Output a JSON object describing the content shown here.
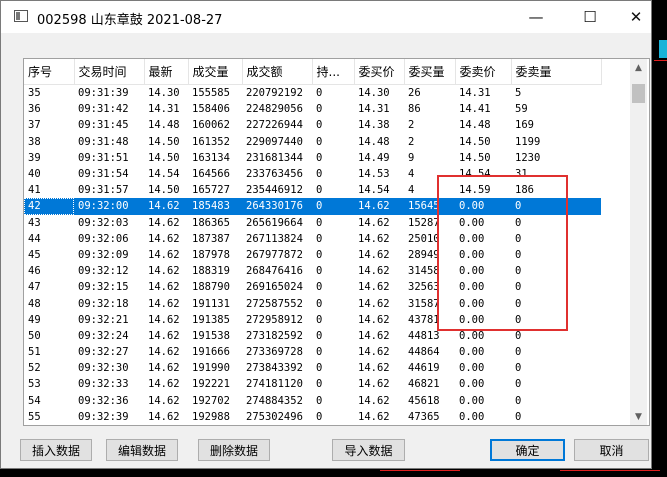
{
  "window": {
    "title": "002598 山东章鼓 2021-08-27",
    "minimize_glyph": "—",
    "maximize_glyph": "☐",
    "close_glyph": "✕"
  },
  "table": {
    "columns": [
      "序号",
      "交易时间",
      "最新",
      "成交量",
      "成交额",
      "持...",
      "委买价",
      "委买量",
      "委卖价",
      "委卖量"
    ],
    "selected_row": 7,
    "rows": [
      [
        "35",
        "09:31:39",
        "14.30",
        "155585",
        "220792192",
        "0",
        "14.30",
        "26",
        "14.31",
        "5"
      ],
      [
        "36",
        "09:31:42",
        "14.31",
        "158406",
        "224829056",
        "0",
        "14.31",
        "86",
        "14.41",
        "59"
      ],
      [
        "37",
        "09:31:45",
        "14.48",
        "160062",
        "227226944",
        "0",
        "14.38",
        "2",
        "14.48",
        "169"
      ],
      [
        "38",
        "09:31:48",
        "14.50",
        "161352",
        "229097440",
        "0",
        "14.48",
        "2",
        "14.50",
        "1199"
      ],
      [
        "39",
        "09:31:51",
        "14.50",
        "163134",
        "231681344",
        "0",
        "14.49",
        "9",
        "14.50",
        "1230"
      ],
      [
        "40",
        "09:31:54",
        "14.54",
        "164566",
        "233763456",
        "0",
        "14.53",
        "4",
        "14.54",
        "31"
      ],
      [
        "41",
        "09:31:57",
        "14.50",
        "165727",
        "235446912",
        "0",
        "14.54",
        "4",
        "14.59",
        "186"
      ],
      [
        "42",
        "09:32:00",
        "14.62",
        "185483",
        "264330176",
        "0",
        "14.62",
        "15645",
        "0.00",
        "0"
      ],
      [
        "43",
        "09:32:03",
        "14.62",
        "186365",
        "265619664",
        "0",
        "14.62",
        "15287",
        "0.00",
        "0"
      ],
      [
        "44",
        "09:32:06",
        "14.62",
        "187387",
        "267113824",
        "0",
        "14.62",
        "25010",
        "0.00",
        "0"
      ],
      [
        "45",
        "09:32:09",
        "14.62",
        "187978",
        "267977872",
        "0",
        "14.62",
        "28949",
        "0.00",
        "0"
      ],
      [
        "46",
        "09:32:12",
        "14.62",
        "188319",
        "268476416",
        "0",
        "14.62",
        "31458",
        "0.00",
        "0"
      ],
      [
        "47",
        "09:32:15",
        "14.62",
        "188790",
        "269165024",
        "0",
        "14.62",
        "32563",
        "0.00",
        "0"
      ],
      [
        "48",
        "09:32:18",
        "14.62",
        "191131",
        "272587552",
        "0",
        "14.62",
        "31587",
        "0.00",
        "0"
      ],
      [
        "49",
        "09:32:21",
        "14.62",
        "191385",
        "272958912",
        "0",
        "14.62",
        "43781",
        "0.00",
        "0"
      ],
      [
        "50",
        "09:32:24",
        "14.62",
        "191538",
        "273182592",
        "0",
        "14.62",
        "44813",
        "0.00",
        "0"
      ],
      [
        "51",
        "09:32:27",
        "14.62",
        "191666",
        "273369728",
        "0",
        "14.62",
        "44864",
        "0.00",
        "0"
      ],
      [
        "52",
        "09:32:30",
        "14.62",
        "191990",
        "273843392",
        "0",
        "14.62",
        "44619",
        "0.00",
        "0"
      ],
      [
        "53",
        "09:32:33",
        "14.62",
        "192221",
        "274181120",
        "0",
        "14.62",
        "46821",
        "0.00",
        "0"
      ],
      [
        "54",
        "09:32:36",
        "14.62",
        "192702",
        "274884352",
        "0",
        "14.62",
        "45618",
        "0.00",
        "0"
      ],
      [
        "55",
        "09:32:39",
        "14.62",
        "192988",
        "275302496",
        "0",
        "14.62",
        "47365",
        "0.00",
        "0"
      ]
    ]
  },
  "scrollbar": {
    "up_glyph": "▲",
    "down_glyph": "▼"
  },
  "buttons": {
    "insert": "插入数据",
    "edit": "编辑数据",
    "delete": "删除数据",
    "import": "导入数据",
    "ok": "确定",
    "cancel": "取消"
  },
  "colors": {
    "selection": "#0078d7",
    "highlight_box": "#e0302f"
  }
}
